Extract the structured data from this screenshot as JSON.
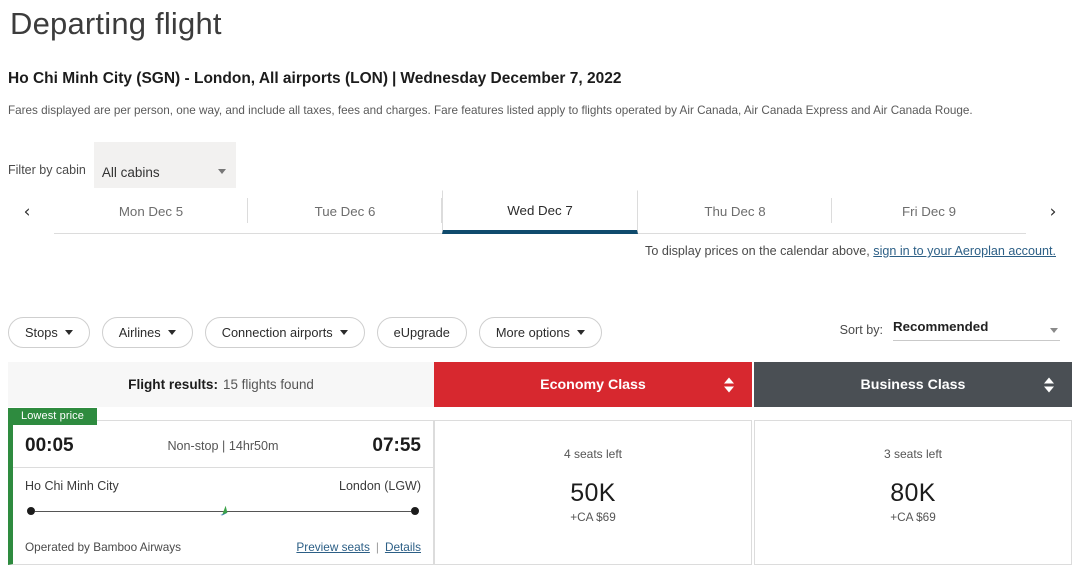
{
  "header": {
    "title": "Departing flight",
    "route_origin": "Ho Chi Minh City (SGN) - London, All airports (LON)",
    "route_separator": "|",
    "route_date": "Wednesday December 7, 2022",
    "fare_note": "Fares displayed are per person, one way, and include all taxes, fees and charges. Fare features listed apply to flights operated by Air Canada, Air Canada Express and Air Canada Rouge."
  },
  "cabin_filter": {
    "label": "Filter by cabin",
    "value": "All cabins",
    "caret_icon": "chevron-down-icon"
  },
  "date_bar": {
    "prev_icon": "chevron-left-icon",
    "next_icon": "chevron-right-icon",
    "prev_glyph": "‹",
    "next_glyph": "›",
    "tabs": [
      {
        "label": "Mon Dec 5",
        "active": false
      },
      {
        "label": "Tue Dec 6",
        "active": false
      },
      {
        "label": "Wed Dec 7",
        "active": true
      },
      {
        "label": "Thu Dec 8",
        "active": false
      },
      {
        "label": "Fri Dec 9",
        "active": false
      }
    ]
  },
  "aeroplan_note": {
    "text": "To display prices on the calendar above, ",
    "link": "sign in to your Aeroplan account."
  },
  "filters": {
    "pills": [
      {
        "label": "Stops",
        "has_caret": true
      },
      {
        "label": "Airlines",
        "has_caret": true
      },
      {
        "label": "Connection airports",
        "has_caret": true
      },
      {
        "label": "eUpgrade",
        "has_caret": false
      },
      {
        "label": "More options",
        "has_caret": true
      }
    ]
  },
  "sort": {
    "label": "Sort by:",
    "value": "Recommended",
    "caret_icon": "chevron-down-icon"
  },
  "results_header": {
    "summary_label": "Flight results:",
    "summary_count": "15 flights found",
    "economy_label": "Economy Class",
    "business_label": "Business Class",
    "sort_icon": "sort-updown-icon"
  },
  "flight": {
    "badge": "Lowest price",
    "depart_time": "00:05",
    "arrive_time": "07:55",
    "stops_duration": "Non-stop | 14hr50m",
    "origin_city": "Ho Chi Minh City",
    "destination_city": "London (LGW)",
    "operated_by": "Operated by Bamboo Airways",
    "preview_seats_link": "Preview seats",
    "links_divider": "|",
    "details_link": "Details",
    "plane_icon": "airplane-icon",
    "economy": {
      "seats_left": "4 seats left",
      "price": "50K",
      "tax": "+CA $69"
    },
    "business": {
      "seats_left": "3 seats left",
      "price": "80K",
      "tax": "+CA $69"
    }
  },
  "colors": {
    "economy_header": "#d7282f",
    "business_header": "#4a4f54",
    "lowest_price_green": "#2e8b3f",
    "active_tab_underline": "#104b6d",
    "link_blue": "#2c5f86"
  }
}
